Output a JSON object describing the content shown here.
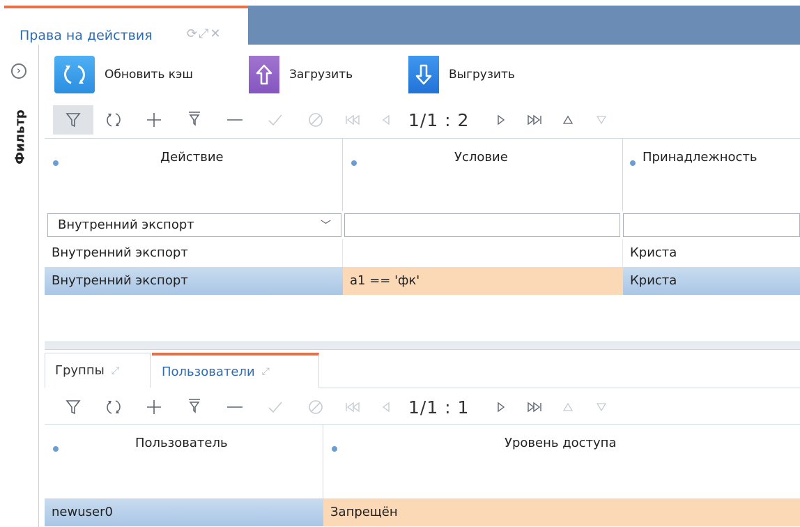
{
  "window": {
    "tab_title": "Права на действия",
    "tab_tools": "⟳⤢✕"
  },
  "sidebar": {
    "toggle_glyph": "›",
    "label": "Фильтр"
  },
  "actions": {
    "refresh_label": "Обновить кэш",
    "upload_label": "Загрузить",
    "download_label": "Выгрузить"
  },
  "toolbar_top": {
    "pager": "1/1 : 2"
  },
  "toolbar_bottom": {
    "pager": "1/1 : 1"
  },
  "rights_table": {
    "columns": [
      "Действие",
      "Условие",
      "Принадлежность"
    ],
    "filter": {
      "action_value": "Внутренний экспорт",
      "condition_value": "",
      "owner_value": ""
    },
    "rows": [
      {
        "action": "Внутренний экспорт",
        "condition": "",
        "owner": "Криста"
      },
      {
        "action": "Внутренний экспорт",
        "condition": "a1 == 'фк'",
        "owner": "Криста"
      }
    ]
  },
  "lower_tabs": {
    "groups_label": "Группы",
    "users_label": "Пользователи"
  },
  "users_table": {
    "columns": [
      "Пользователь",
      "Уровень доступа"
    ],
    "rows": [
      {
        "user": "newuser0",
        "access": "Запрещён"
      }
    ]
  },
  "colors": {
    "tabbar": "#6b8db5",
    "accent_orange": "#e8714a",
    "link_blue": "#2f6bb0",
    "selection_blue": "#b7d0ea",
    "selection_orange": "#fcd9b6"
  }
}
